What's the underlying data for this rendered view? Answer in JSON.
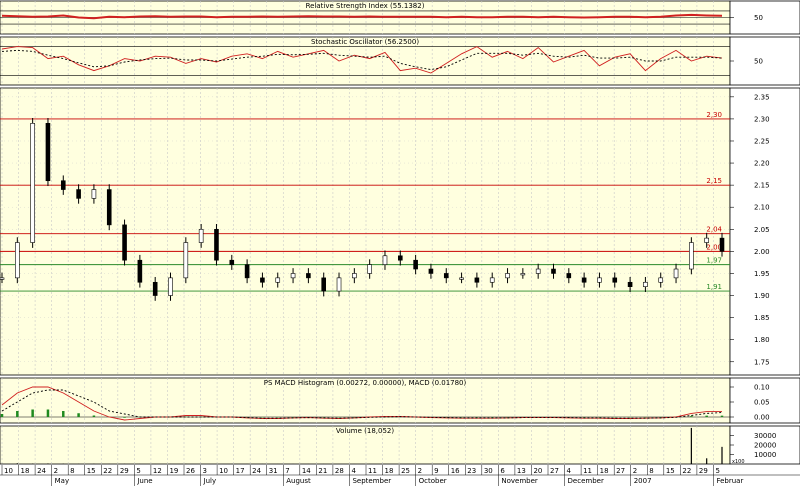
{
  "chart_data": {
    "type": "line",
    "x_start": "2006-04-10",
    "x_end": "2007-02-06",
    "colors": {
      "panel_bg": "#ffffdf",
      "grid": "#c9c9c9",
      "price_line": "#c80000",
      "support_line": "#2a8a2a",
      "indicator": "#d02020",
      "bar_up": "#ffffff",
      "bar_down": "#000000",
      "macd_hist": "#1f8a1f"
    },
    "panels": [
      {
        "id": "rsi",
        "title": "Relative Strength Index (55.1382)",
        "y_ticks": [
          "50"
        ],
        "ylim": [
          0,
          100
        ],
        "reference_levels": [
          30,
          50,
          70
        ],
        "series": [
          {
            "values": [
              55,
              54,
              52,
              53,
              56,
              50,
              48,
              52,
              51,
              53,
              54,
              52,
              53,
              53,
              51,
              52,
              52,
              53,
              52,
              53,
              54,
              53,
              53,
              52,
              53,
              52,
              52,
              52,
              52,
              51,
              52,
              51,
              51,
              52,
              52,
              51,
              52,
              51,
              50,
              51,
              52,
              52,
              51,
              52,
              56,
              58,
              56,
              55
            ]
          }
        ]
      },
      {
        "id": "stochastic",
        "title": "Stochastic Oscillator (56.2500)",
        "y_ticks": [
          "50"
        ],
        "ylim": [
          0,
          100
        ],
        "reference_levels": [
          20,
          80
        ],
        "series": [
          {
            "style": "solid",
            "values": [
              75,
              80,
              78,
              55,
              60,
              42,
              30,
              40,
              55,
              50,
              60,
              58,
              45,
              55,
              48,
              60,
              65,
              55,
              70,
              58,
              65,
              72,
              50,
              62,
              55,
              68,
              30,
              35,
              25,
              45,
              65,
              80,
              58,
              70,
              55,
              78,
              48,
              60,
              72,
              40,
              58,
              65,
              30,
              55,
              72,
              50,
              60,
              56
            ]
          },
          {
            "style": "dashed",
            "values": [
              70,
              72,
              70,
              62,
              55,
              46,
              38,
              40,
              48,
              52,
              55,
              56,
              52,
              52,
              50,
              54,
              58,
              60,
              64,
              63,
              64,
              66,
              62,
              60,
              58,
              60,
              45,
              38,
              32,
              38,
              52,
              66,
              66,
              66,
              62,
              66,
              60,
              58,
              62,
              56,
              56,
              58,
              50,
              50,
              58,
              58,
              58,
              56
            ]
          }
        ]
      },
      {
        "id": "price",
        "title": "",
        "type": "ohlc",
        "y_ticks": [
          "2.35",
          "2.30",
          "2.25",
          "2.20",
          "2.15",
          "2.10",
          "2.05",
          "2.00",
          "1.95",
          "1.90",
          "1.85",
          "1.80",
          "1.75"
        ],
        "ylim": [
          1.72,
          2.37
        ],
        "horizontal_lines": [
          {
            "value": 2.3,
            "label": "2,30",
            "color": "red"
          },
          {
            "value": 2.15,
            "label": "2,15",
            "color": "red"
          },
          {
            "value": 2.04,
            "label": "2,04",
            "color": "red"
          },
          {
            "value": 2.0,
            "label": "2,00",
            "color": "red"
          },
          {
            "value": 1.97,
            "label": "1,97",
            "color": "green"
          },
          {
            "value": 1.91,
            "label": "1,91",
            "color": "green"
          }
        ],
        "series": [
          {
            "name": "Close",
            "values": [
              1.94,
              2.02,
              2.29,
              2.16,
              2.14,
              2.12,
              2.14,
              2.06,
              1.98,
              1.93,
              1.9,
              1.94,
              2.02,
              2.05,
              1.98,
              1.97,
              1.94,
              1.93,
              1.94,
              1.95,
              1.94,
              1.91,
              1.94,
              1.95,
              1.97,
              1.99,
              1.98,
              1.96,
              1.95,
              1.94,
              1.94,
              1.93,
              1.94,
              1.95,
              1.95,
              1.96,
              1.95,
              1.94,
              1.93,
              1.94,
              1.93,
              1.92,
              1.93,
              1.94,
              1.96,
              2.02,
              2.03,
              2.0
            ]
          }
        ]
      },
      {
        "id": "macd",
        "title": "PS MACD Histogram (0.00272, 0.00000), MACD (0.01780)",
        "y_ticks": [
          "0.10",
          "0.05",
          "0.00"
        ],
        "ylim": [
          -0.02,
          0.13
        ],
        "series": [
          {
            "style": "solid",
            "values": [
              0.04,
              0.08,
              0.1,
              0.1,
              0.08,
              0.05,
              0.02,
              0.0,
              -0.01,
              -0.005,
              0.0,
              0.0,
              0.005,
              0.005,
              0.0,
              0.0,
              -0.003,
              -0.005,
              -0.005,
              -0.003,
              -0.002,
              -0.004,
              -0.005,
              -0.003,
              0.0,
              0.002,
              0.002,
              0.0,
              -0.002,
              -0.003,
              -0.004,
              -0.004,
              -0.004,
              -0.003,
              -0.002,
              -0.002,
              -0.002,
              -0.003,
              -0.004,
              -0.004,
              -0.005,
              -0.005,
              -0.004,
              -0.003,
              0.0,
              0.012,
              0.018,
              0.018
            ]
          },
          {
            "style": "dashed",
            "values": [
              0.02,
              0.05,
              0.08,
              0.09,
              0.09,
              0.07,
              0.05,
              0.02,
              0.01,
              0.0,
              0.0,
              0.0,
              0.0,
              0.0,
              0.0,
              0.0,
              -0.002,
              -0.004,
              -0.004,
              -0.003,
              -0.002,
              -0.003,
              -0.004,
              -0.003,
              -0.001,
              0.0,
              0.001,
              0.0,
              -0.001,
              -0.002,
              -0.003,
              -0.003,
              -0.003,
              -0.003,
              -0.002,
              -0.002,
              -0.002,
              -0.002,
              -0.003,
              -0.003,
              -0.004,
              -0.004,
              -0.004,
              -0.003,
              -0.001,
              0.005,
              0.012,
              0.015
            ]
          }
        ]
      },
      {
        "id": "volume",
        "title": "Volume (18,052)",
        "y_ticks": [
          "30000",
          "20000",
          "10000"
        ],
        "ylim": [
          0,
          40000
        ],
        "axis_unit": "x100",
        "series": [
          {
            "name": "Volume",
            "values": [
              300,
              800,
              500,
              600,
              400,
              200,
              300,
              100,
              200,
              100,
              50,
              100,
              200,
              150,
              100,
              50,
              100,
              80,
              60,
              100,
              80,
              70,
              60,
              50,
              100,
              80,
              60,
              50,
              70,
              60,
              50,
              40,
              60,
              50,
              70,
              60,
              50,
              40,
              50,
              60,
              50,
              40,
              60,
              80,
              100,
              38000,
              6000,
              18052
            ]
          }
        ]
      }
    ],
    "x_day_ticks": [
      "10",
      "18",
      "24",
      "2",
      "8",
      "15",
      "22",
      "29",
      "5",
      "12",
      "19",
      "26",
      "3",
      "10",
      "17",
      "24",
      "31",
      "7",
      "14",
      "21",
      "28",
      "4",
      "11",
      "18",
      "25",
      "2",
      "9",
      "16",
      "23",
      "30",
      "6",
      "13",
      "20",
      "27",
      "4",
      "11",
      "18",
      "27",
      "2",
      "8",
      "15",
      "22",
      "29",
      "5"
    ],
    "x_month_labels": [
      "May",
      "June",
      "July",
      "August",
      "September",
      "October",
      "November",
      "December",
      "2007",
      "Februar"
    ]
  }
}
